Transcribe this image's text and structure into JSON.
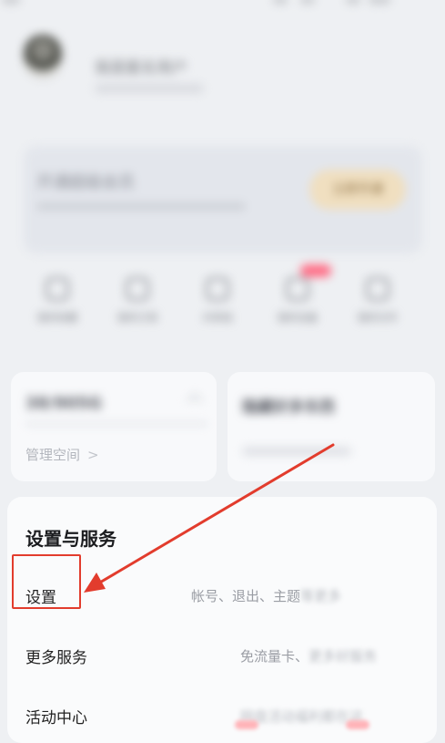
{
  "profile": {
    "username": "我是匿名用户"
  },
  "vip": {
    "title": "开通超级会员",
    "button_label": "立即开通"
  },
  "quick_actions": [
    {
      "label": "我的收藏"
    },
    {
      "label": "我的订阅"
    },
    {
      "label": "共享组"
    },
    {
      "label": "我的设备"
    },
    {
      "label": "我的文件"
    }
  ],
  "storage": {
    "amount": "38/905G",
    "manage_label": "管理空间",
    "manage_chevron": ">"
  },
  "right_card": {
    "title": "隐藏好多东西"
  },
  "settings_section": {
    "title": "设置与服务",
    "items": [
      {
        "label": "设置",
        "desc": "帐号、退出、主题",
        "desc_faded": "等更多"
      },
      {
        "label": "更多服务",
        "desc": "免流量卡、",
        "desc_faded": "更多好服务"
      },
      {
        "label": "活动中心",
        "desc": "",
        "desc_faded": "网盘活动福利都在这"
      }
    ]
  },
  "colors": {
    "highlight": "#e23c2d",
    "arrow": "#e23c2d"
  }
}
